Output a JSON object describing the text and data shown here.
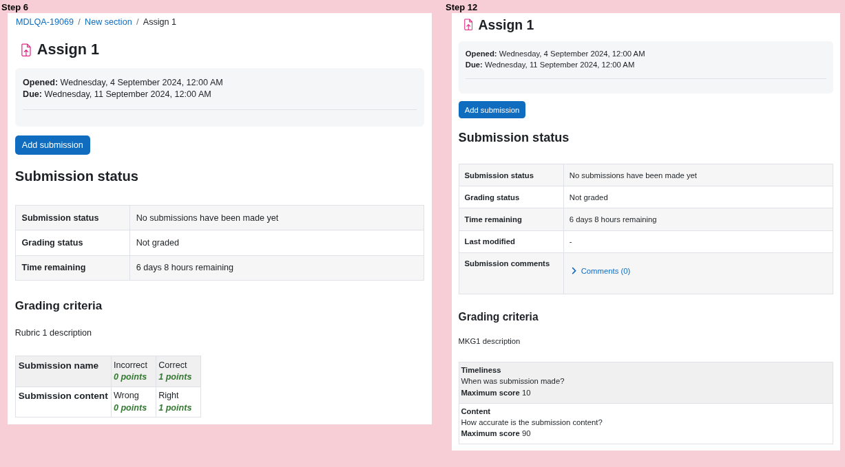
{
  "panels": [
    {
      "step_label": "Step 6",
      "breadcrumb": [
        {
          "label": "MDLQA-19069",
          "link": true
        },
        {
          "separator": "/",
          "label": "New section",
          "link": true
        },
        {
          "separator": "/",
          "label": "Assign 1",
          "link": false
        }
      ],
      "title": "Assign 1",
      "dates": [
        {
          "label": "Opened:",
          "value": "Wednesday, 4 September 2024, 12:00 AM"
        },
        {
          "label": "Due:",
          "value": "Wednesday, 11 September 2024, 12:00 AM"
        }
      ],
      "button": "Add submission",
      "status_heading": "Submission status",
      "status_rows": [
        {
          "kind": "text",
          "label": "Submission status",
          "value": "No submissions have been made yet"
        },
        {
          "kind": "text",
          "label": "Grading status",
          "value": "Not graded"
        },
        {
          "kind": "text",
          "label": "Time remaining",
          "value": "6 days 8 hours remaining"
        }
      ],
      "grading_heading": "Grading criteria",
      "grading_description": "Rubric 1 description",
      "grading": {
        "kind": "rubric",
        "criteria": [
          {
            "name": "Submission name",
            "levels": [
              {
                "definition": "Incorrect",
                "score": "0 points"
              },
              {
                "definition": "Correct",
                "score": "1 points"
              }
            ]
          },
          {
            "name": "Submission content",
            "levels": [
              {
                "definition": "Wrong",
                "score": "0 points"
              },
              {
                "definition": "Right",
                "score": "1 points"
              }
            ]
          }
        ]
      }
    },
    {
      "step_label": "Step 12",
      "title": "Assign 1",
      "dates": [
        {
          "label": "Opened:",
          "value": "Wednesday, 4 September 2024, 12:00 AM"
        },
        {
          "label": "Due:",
          "value": "Wednesday, 11 September 2024, 12:00 AM"
        }
      ],
      "button": "Add submission",
      "status_heading": "Submission status",
      "status_rows": [
        {
          "kind": "text",
          "label": "Submission status",
          "value": "No submissions have been made yet"
        },
        {
          "kind": "text",
          "label": "Grading status",
          "value": "Not graded"
        },
        {
          "kind": "text",
          "label": "Time remaining",
          "value": "6 days 8 hours remaining"
        },
        {
          "kind": "text",
          "label": "Last modified",
          "value": "-"
        },
        {
          "kind": "comments",
          "label": "Submission comments",
          "value": "Comments (0)"
        }
      ],
      "grading_heading": "Grading criteria",
      "grading_description": "MKG1 description",
      "grading": {
        "kind": "marking_guide",
        "criteria": [
          {
            "name": "Timeliness",
            "description": "When was submission made?",
            "max_label": "Maximum score",
            "max_value": "10"
          },
          {
            "name": "Content",
            "description": "How accurate is the submission content?",
            "max_label": "Maximum score",
            "max_value": "90"
          }
        ]
      }
    }
  ]
}
